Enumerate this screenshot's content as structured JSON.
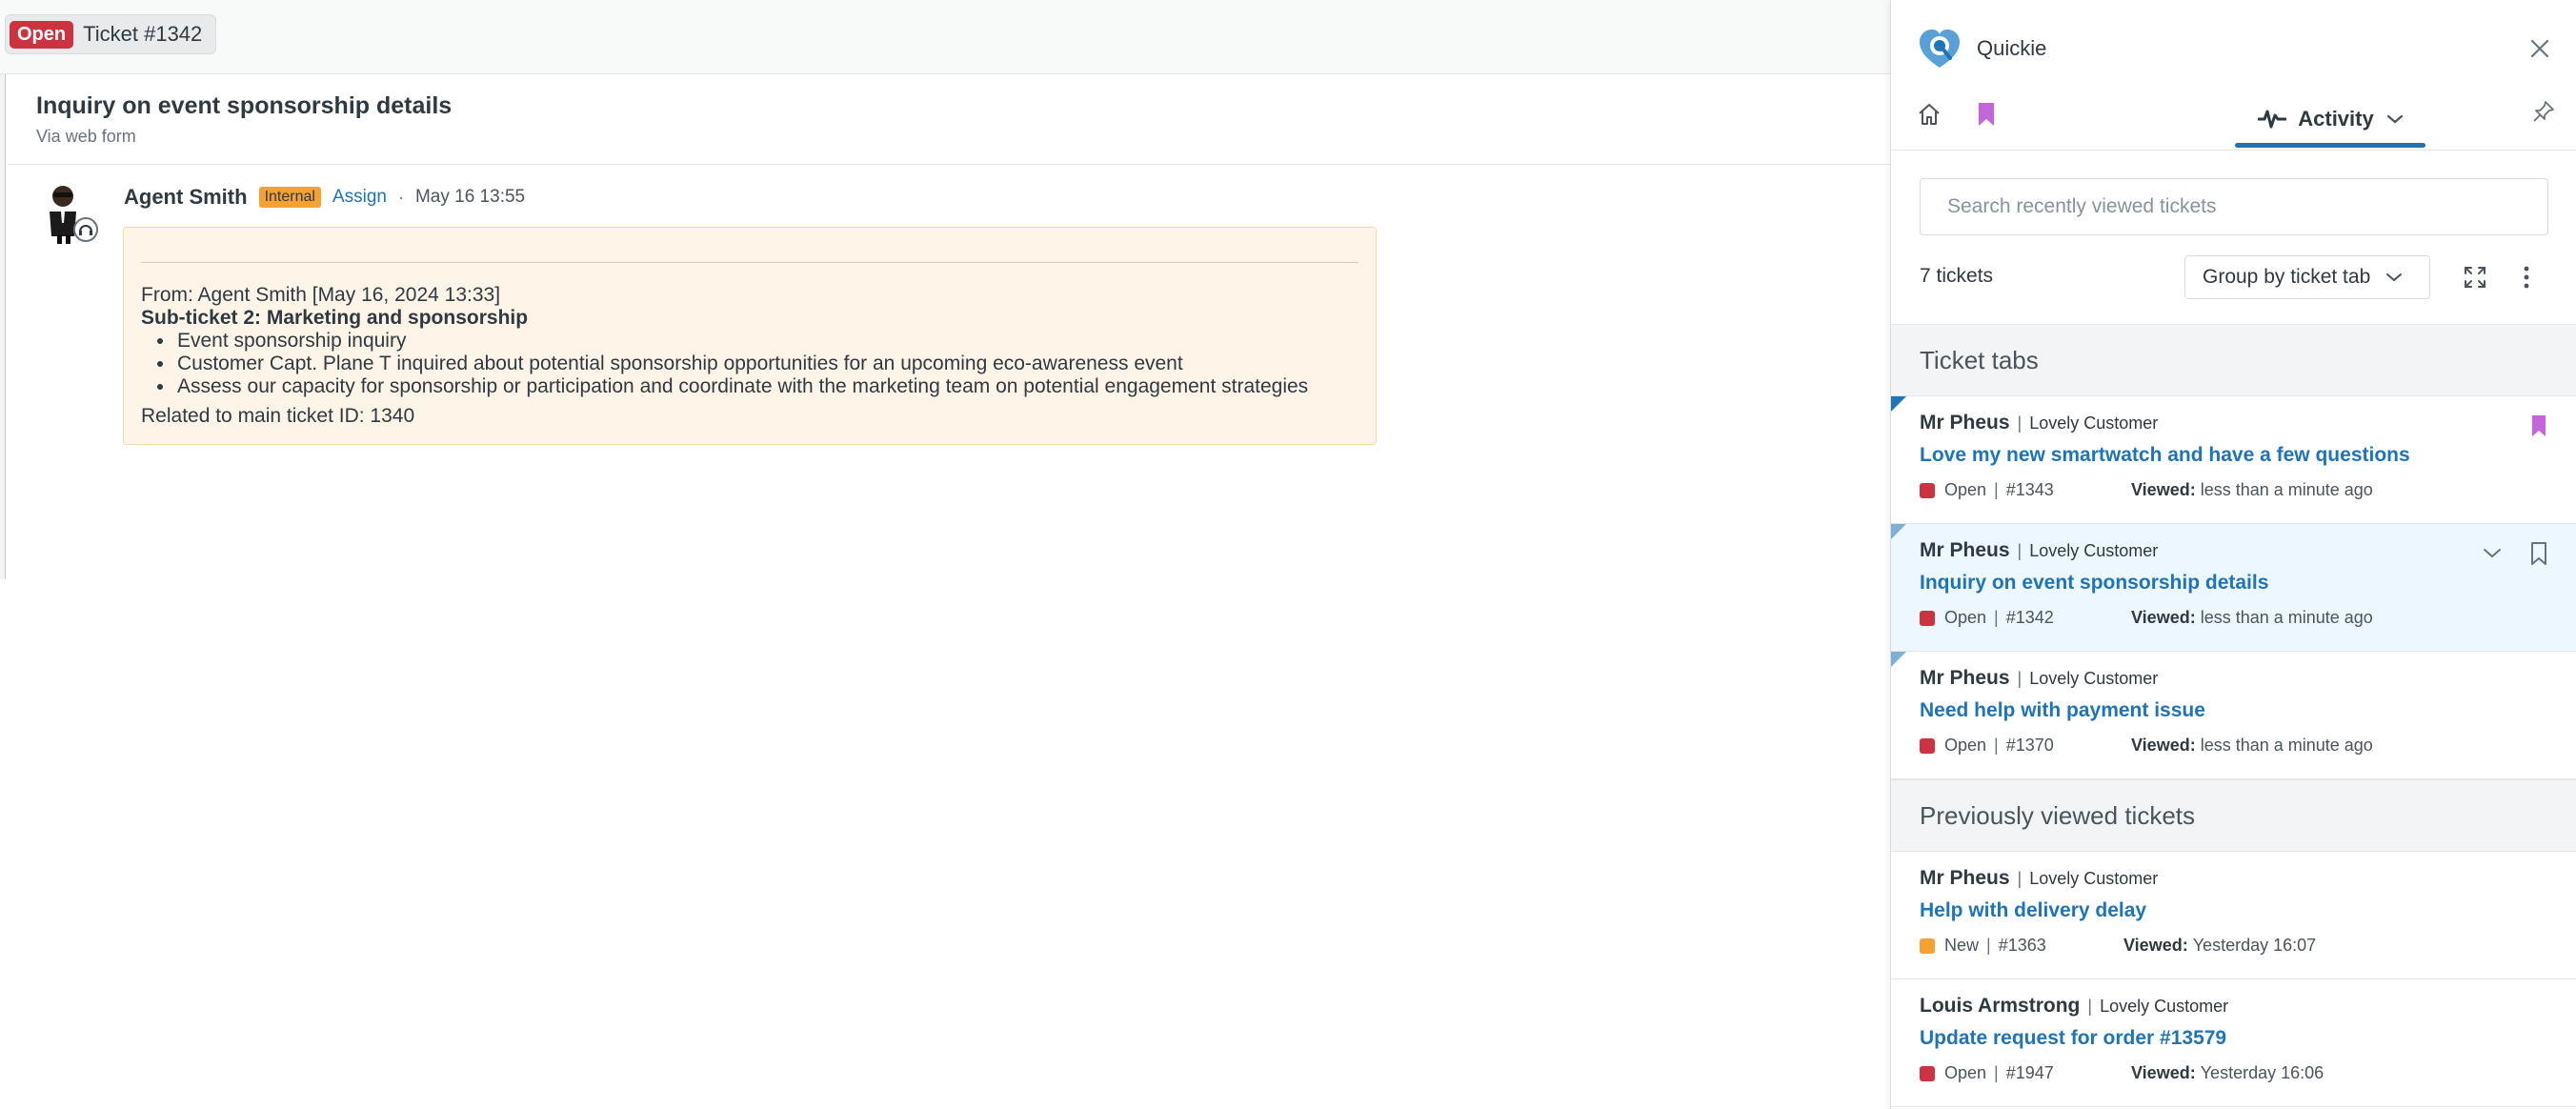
{
  "ticket_tab": {
    "status": "Open",
    "title": "Ticket #1342"
  },
  "ticket": {
    "subject": "Inquiry on event sponsorship details",
    "via": "Via web form"
  },
  "message": {
    "author": "Agent Smith",
    "badge": "Internal",
    "assign": "Assign",
    "dot": "·",
    "time": "May 16 13:55",
    "from": "From: Agent Smith [May 16, 2024 13:33]",
    "sub_title": "Sub-ticket 2: Marketing and sponsorship",
    "bullets": [
      "Event sponsorship inquiry",
      "Customer Capt. Plane T inquired about potential sponsorship opportunities for an upcoming eco-awareness event",
      "Assess our capacity for sponsorship or participation and coordinate with the marketing team on potential engagement strategies"
    ],
    "related": "Related to main ticket ID: 1340"
  },
  "panel": {
    "app_name": "Quickie",
    "activity_label": "Activity",
    "search_placeholder": "Search recently viewed tickets",
    "count": "7 tickets",
    "group_by": "Group by ticket tab",
    "section_tabs": "Ticket tabs",
    "section_prev": "Previously viewed tickets",
    "viewed_label": "Viewed:",
    "sep": "|",
    "rows": [
      {
        "name": "Mr Pheus",
        "org": "Lovely Customer",
        "subject": "Love my new smartwatch and have a few questions",
        "status": "Open",
        "id": "#1343",
        "viewed": "less than a minute ago"
      },
      {
        "name": "Mr Pheus",
        "org": "Lovely Customer",
        "subject": "Inquiry on event sponsorship details",
        "status": "Open",
        "id": "#1342",
        "viewed": "less than a minute ago"
      },
      {
        "name": "Mr Pheus",
        "org": "Lovely Customer",
        "subject": "Need help with payment issue",
        "status": "Open",
        "id": "#1370",
        "viewed": "less than a minute ago"
      },
      {
        "name": "Mr Pheus",
        "org": "Lovely Customer",
        "subject": "Help with delivery delay",
        "status": "New",
        "id": "#1363",
        "viewed": "Yesterday 16:07"
      },
      {
        "name": "Louis Armstrong",
        "org": "Lovely Customer",
        "subject": "Update request for order #13579",
        "status": "Open",
        "id": "#1947",
        "viewed": "Yesterday 16:06"
      }
    ]
  },
  "colors": {
    "open": "#cc3340",
    "new": "#f5a133",
    "link": "#1f73b7",
    "bookmark": "#c266d9",
    "internal": "#f5a133",
    "message_bg": "#fff4e8"
  },
  "icons": [
    "quickie-logo-icon",
    "close-icon",
    "home-icon",
    "bookmark-icon",
    "activity-icon",
    "chevron-down-icon",
    "pin-icon",
    "expand-icon",
    "more-vertical-icon",
    "agent-avatar"
  ]
}
